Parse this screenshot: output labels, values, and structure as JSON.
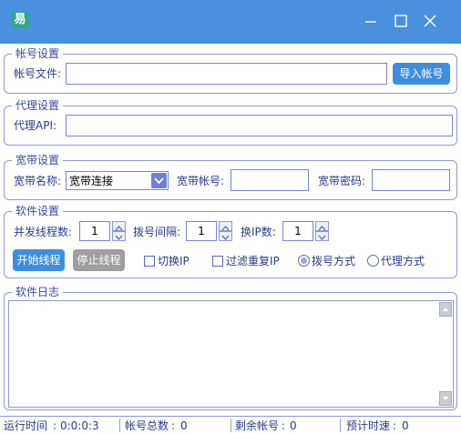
{
  "window": {
    "app_icon": "易",
    "controls": [
      "minimize-icon",
      "maximize-icon",
      "close-icon"
    ]
  },
  "account": {
    "title": "帐号设置",
    "file_label": "帐号文件:",
    "file_value": "",
    "import_button": "导入帐号"
  },
  "proxy": {
    "title": "代理设置",
    "api_label": "代理API:",
    "api_value": ""
  },
  "broadband": {
    "title": "宽带设置",
    "name_label": "宽带名称:",
    "name_value": "宽带连接",
    "account_label": "宽带帐号:",
    "account_value": "",
    "password_label": "宽带密码:",
    "password_value": ""
  },
  "software": {
    "title": "软件设置",
    "threads_label": "并发线程数:",
    "threads_value": "1",
    "dial_interval_label": "拨号间隔:",
    "dial_interval_value": "1",
    "ip_count_label": "换IP数:",
    "ip_count_value": "1",
    "start_button": "开始线程",
    "stop_button": "停止线程",
    "switch_ip_label": "切换IP",
    "switch_ip_checked": false,
    "filter_ip_label": "过滤重复IP",
    "filter_ip_checked": false,
    "dial_mode_label": "拨号方式",
    "proxy_mode_label": "代理方式",
    "selected_mode": "拨号方式"
  },
  "log": {
    "title": "软件日志",
    "content": ""
  },
  "status": {
    "run_time_label": "运行时间",
    "run_time_value": "0:0:0:3",
    "total_accounts_label": "帐号总数",
    "total_accounts_value": "0",
    "remaining_accounts_label": "剩余帐号",
    "remaining_accounts_value": "0",
    "estimated_speed_label": "预计时速",
    "estimated_speed_value": "0"
  },
  "colors": {
    "titlebar": "#4a90dc",
    "border": "#8f98d8",
    "text": "#2a3a8a",
    "primary_button": "#3e8ee0",
    "disabled_button": "#9e9e9e"
  }
}
